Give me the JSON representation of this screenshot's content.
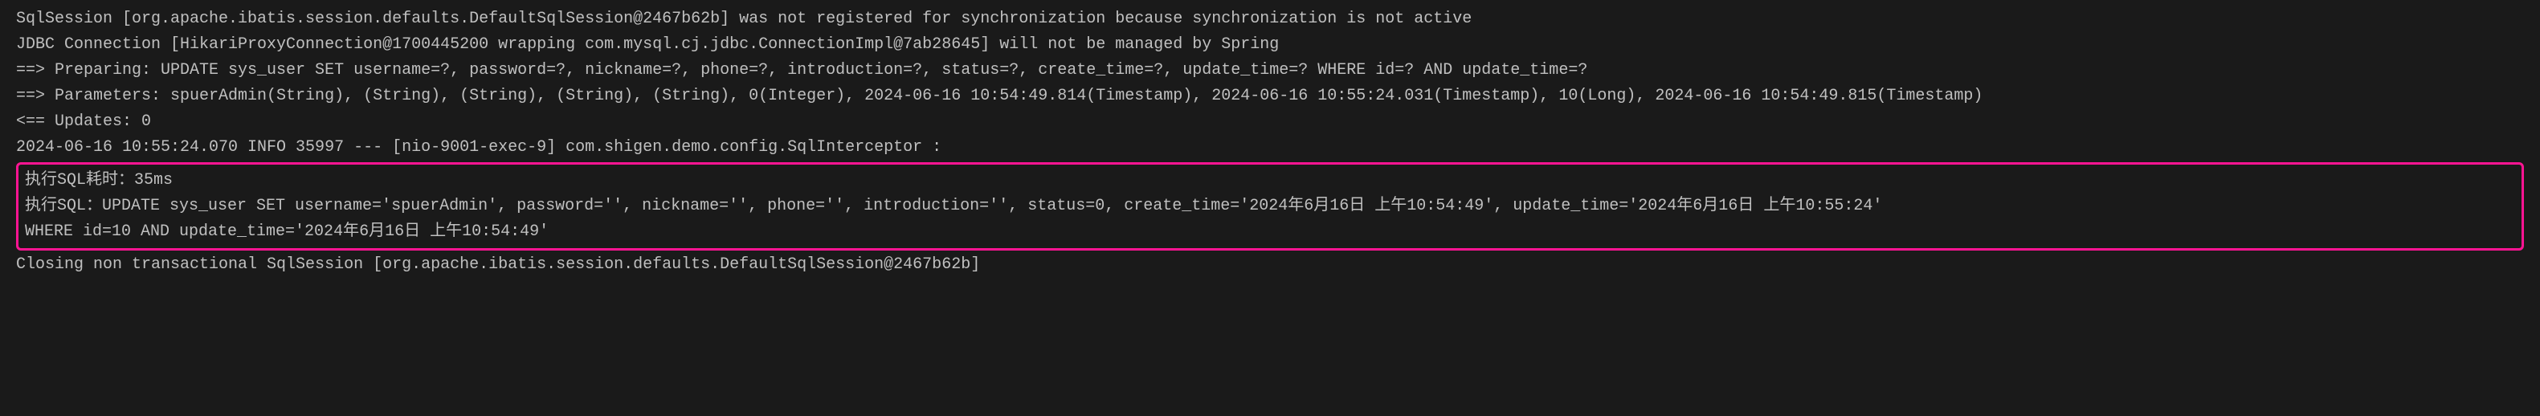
{
  "lines": {
    "line1": "SqlSession [org.apache.ibatis.session.defaults.DefaultSqlSession@2467b62b] was not registered for synchronization because synchronization is not active",
    "line2": "JDBC Connection [HikariProxyConnection@1700445200 wrapping com.mysql.cj.jdbc.ConnectionImpl@7ab28645] will not be managed by Spring",
    "line3": "==>  Preparing: UPDATE sys_user SET username=?, password=?, nickname=?, phone=?, introduction=?, status=?, create_time=?, update_time=? WHERE id=? AND update_time=?",
    "line4": "==> Parameters: spuerAdmin(String), (String), (String), (String), (String), 0(Integer), 2024-06-16 10:54:49.814(Timestamp), 2024-06-16 10:55:24.031(Timestamp), 10(Long), 2024-06-16 10:54:49.815(Timestamp)",
    "line5": "<==    Updates: 0",
    "line6": "2024-06-16 10:55:24.070  INFO 35997 --- [nio-9001-exec-9] com.shigen.demo.config.SqlInterceptor    :",
    "highlighted": {
      "line1": "执行SQL耗时：35ms",
      "line2": "执行SQL：UPDATE sys_user SET username='spuerAdmin', password='', nickname='', phone='', introduction='', status=0, create_time='2024年6月16日 上午10:54:49', update_time='2024年6月16日 上午10:55:24'",
      "line3": " WHERE id=10 AND update_time='2024年6月16日 上午10:54:49'"
    },
    "line7": "Closing non transactional SqlSession [org.apache.ibatis.session.defaults.DefaultSqlSession@2467b62b]"
  }
}
